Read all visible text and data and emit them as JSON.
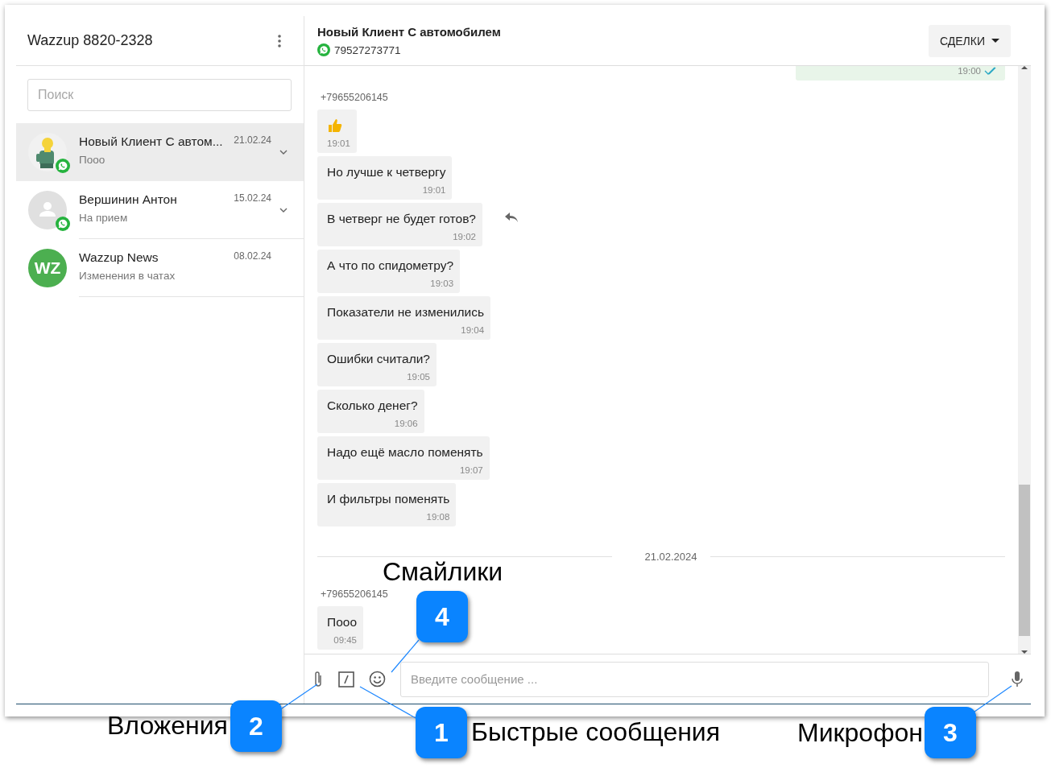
{
  "account": {
    "title": "Wazzup 8820-2328"
  },
  "search": {
    "placeholder": "Поиск"
  },
  "chats": [
    {
      "name": "Новый Клиент С автом...",
      "preview": "Пооо",
      "date": "21.02.24",
      "kind": "picture",
      "whatsapp": true,
      "menu": true,
      "selected": true
    },
    {
      "name": "Вершинин Антон",
      "preview": "На прием",
      "date": "15.02.24",
      "kind": "placeholder",
      "whatsapp": true,
      "menu": true,
      "selected": false
    },
    {
      "name": "Wazzup News",
      "preview": "Изменения в чатах",
      "date": "08.02.24",
      "kind": "initials",
      "initials": "WZ",
      "whatsapp": false,
      "menu": false,
      "selected": false
    }
  ],
  "chat_header": {
    "title": "Новый Клиент С автомобилем",
    "phone": "79527273771",
    "deals_button": "СДЕЛКИ"
  },
  "messages": [
    {
      "kind": "outgoing",
      "time": "19:00",
      "read": true
    },
    {
      "kind": "sender",
      "text": "+79655206145"
    },
    {
      "kind": "thumbs",
      "time": "19:01",
      "hovered": false
    },
    {
      "kind": "incoming",
      "text": "Но лучше к четвергу",
      "time": "19:01",
      "hovered": false
    },
    {
      "kind": "incoming",
      "text": "В четверг не будет готов?",
      "time": "19:02",
      "hovered": true
    },
    {
      "kind": "incoming",
      "text": "А что по спидометру?",
      "time": "19:03",
      "hovered": false
    },
    {
      "kind": "incoming",
      "text": "Показатели не изменились",
      "time": "19:04",
      "hovered": false
    },
    {
      "kind": "incoming",
      "text": "Ошибки считали?",
      "time": "19:05",
      "hovered": false
    },
    {
      "kind": "incoming",
      "text": "Сколько денег?",
      "time": "19:06",
      "hovered": false
    },
    {
      "kind": "incoming",
      "text": "Надо ещё масло поменять",
      "time": "19:07",
      "hovered": false
    },
    {
      "kind": "incoming",
      "text": "И фильтры поменять",
      "time": "19:08",
      "hovered": false
    },
    {
      "kind": "date",
      "text": "21.02.2024"
    },
    {
      "kind": "sender",
      "text": "+79655206145"
    },
    {
      "kind": "incoming",
      "text": "Пооо",
      "time": "09:45",
      "hovered": false
    }
  ],
  "composer": {
    "placeholder": "Введите сообщение ..."
  },
  "callouts": [
    {
      "number": "4",
      "label": "Смайлики",
      "kind": "emoji"
    },
    {
      "number": "2",
      "label": "Вложения",
      "kind": "attach"
    },
    {
      "number": "1",
      "label": "Быстрые сообщения",
      "kind": "quick"
    },
    {
      "number": "3",
      "label": "Микрофон",
      "kind": "mic"
    }
  ]
}
